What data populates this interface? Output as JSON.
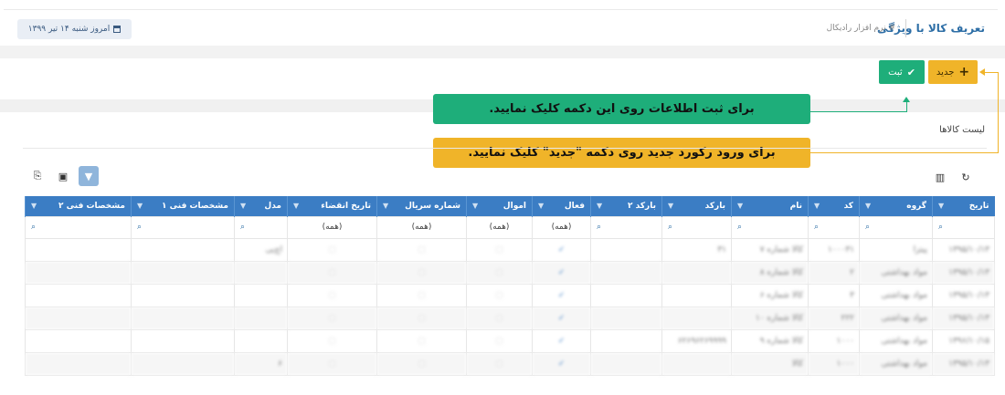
{
  "header": {
    "title": "تعریف کالا با ویژگی",
    "breadcrumb": "# نرم افزار رادیکال",
    "date": "امروز شنبه ۱۴ تیر ۱۳۹۹"
  },
  "toolbar": {
    "new_label": "جدید",
    "save_label": "ثبت"
  },
  "list_title": "لیست کالاها",
  "callouts": {
    "save_hint": "برای ثبت اطلاعات روی این دکمه کلیک نمایید.",
    "new_hint": "برای ورود رکورد جدید روی دکمه \"جدید\" کلیک نمایید."
  },
  "icons": {
    "new": "plus-icon",
    "save": "check-icon",
    "date": "calendar-icon",
    "refresh": "refresh-icon",
    "columns": "column-chooser-icon",
    "filter": "filter-icon",
    "excel": "excel-icon",
    "export": "export-icon",
    "search": "search-icon"
  },
  "colors": {
    "primary": "#3b7dc4",
    "success": "#1eae7a",
    "warning": "#f0b429",
    "title": "#2d6ea6"
  },
  "table": {
    "columns": [
      "تاریخ",
      "گروه",
      "کد",
      "نام",
      "بارکد",
      "بارکد ۲",
      "فعال",
      "اموال",
      "شماره سریال",
      "تاریخ انقضاء",
      "مدل",
      "مشخصات فنی ۱",
      "مشخصات فنی ۲"
    ],
    "filters": [
      "",
      "",
      "",
      "",
      "",
      "",
      "(همه)",
      "(همه)",
      "(همه)",
      "(همه)",
      "",
      "",
      ""
    ],
    "rows": [
      [
        "۱۳۹۵/۱۰/۱۳",
        "پیتزا",
        "۱۰۰۰۳۱",
        "کالا شماره ۷",
        "۳۱",
        "",
        "✓",
        "▢",
        "▢",
        "▢",
        "اچ‌پی",
        "",
        ""
      ],
      [
        "۱۳۹۵/۱۰/۱۳",
        "مواد بهداشتی",
        "۲",
        "کالا شماره ۸",
        "",
        "",
        "✓",
        "▢",
        "▢",
        "▢",
        "",
        "",
        ""
      ],
      [
        "۱۳۹۵/۱۰/۱۳",
        "مواد بهداشتی",
        "۳",
        "کالا شماره ۶",
        "",
        "",
        "✓",
        "▢",
        "▢",
        "▢",
        "",
        "",
        ""
      ],
      [
        "۱۳۹۵/۱۰/۱۳",
        "مواد بهداشتی",
        "۲۲۲",
        "کالا شماره ۱۰",
        "",
        "",
        "✓",
        "▢",
        "▢",
        "▢",
        "",
        "",
        ""
      ],
      [
        "۱۳۹۶/۱۰/۱۵",
        "مواد بهداشتی",
        "۱۰۰۰",
        "کالا شماره ۹",
        "۶۲۶۹۶۲۶۹۹۹۹",
        "",
        "✓",
        "▢",
        "▢",
        "▢",
        "",
        "",
        ""
      ],
      [
        "۱۳۹۵/۱۰/۱۳",
        "مواد بهداشتی",
        "۱۰۰۰",
        "کالا",
        "",
        "",
        "✓",
        "▢",
        "▢",
        "▢",
        "۶",
        "",
        ""
      ]
    ]
  }
}
